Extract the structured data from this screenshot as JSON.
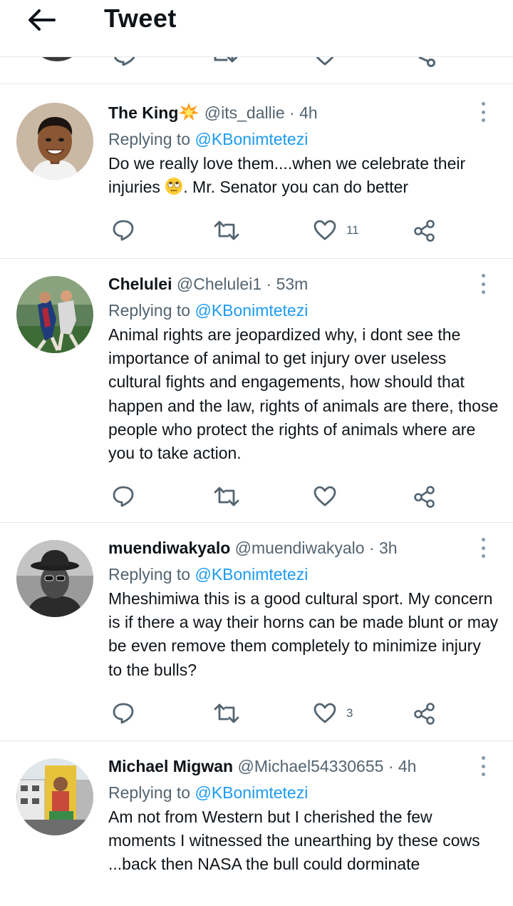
{
  "header": {
    "title": "Tweet"
  },
  "reply_prefix": "Replying to ",
  "tweets": [
    {
      "name": "The King",
      "handle": "@its_dallie",
      "time": "4h",
      "reply_to": "@KBonimtetezi",
      "text_parts": [
        "Do we really love them....when we celebrate their injuries ",
        ". Mr. Senator you can do better"
      ],
      "likes": "11"
    },
    {
      "name": "Chelulei",
      "handle": "@Chelulei1",
      "time": "53m",
      "reply_to": "@KBonimtetezi",
      "text": "Animal rights are jeopardized why, i dont see the importance of animal to get injury over useless cultural fights and engagements, how should that happen and the law, rights of animals are there, those people who protect the rights of animals where are you to take action.",
      "likes": ""
    },
    {
      "name": "muendiwakyalo",
      "handle": "@muendiwakyalo",
      "time": "3h",
      "reply_to": "@KBonimtetezi",
      "text": "Mheshimiwa this is a good cultural sport. My concern is if there a way their horns can be made blunt or may be even remove them completely to minimize injury to the bulls?",
      "likes": "3"
    },
    {
      "name": "Michael Migwan",
      "handle": "@Michael54330655",
      "time": "4h",
      "reply_to": "@KBonimtetezi",
      "text": "Am not from Western but I cherished the few moments I witnessed the unearthing by these cows ...back then NASA the bull could dorminate",
      "likes": ""
    }
  ],
  "separator": "·",
  "icons": {
    "back": "back-arrow-icon",
    "reply": "reply-icon",
    "retweet": "retweet-icon",
    "like": "heart-icon",
    "share": "share-icon",
    "more": "more-vertical-icon",
    "name_emoji": "collision-emoji-icon",
    "text_emoji": "eye-roll-emoji-icon"
  },
  "colors": {
    "link": "#1d9bf0",
    "secondary": "#536471",
    "icon": "#536471",
    "text": "#0f1419"
  }
}
